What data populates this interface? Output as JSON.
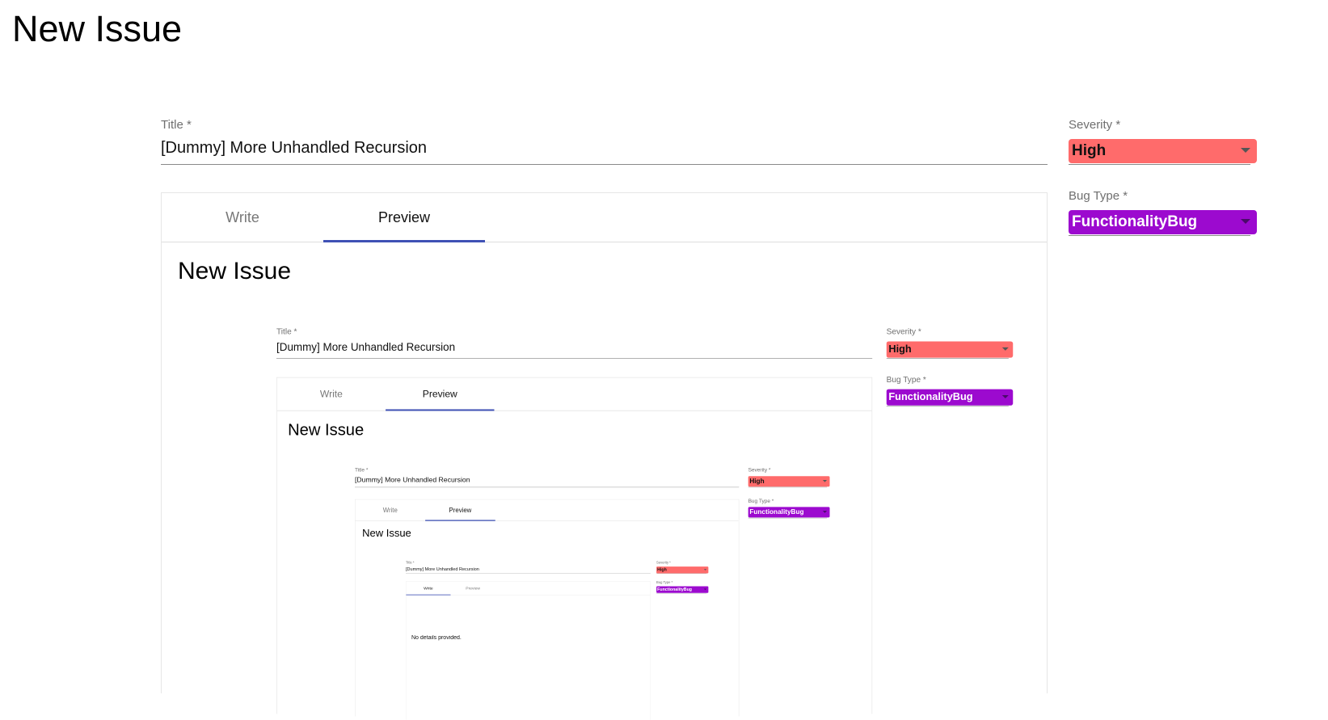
{
  "page": {
    "title": "New Issue"
  },
  "form": {
    "title_label": "Title *",
    "title_value": "[Dummy] More Unhandled Recursion",
    "tabs": [
      {
        "label": "Write",
        "active": false
      },
      {
        "label": "Preview",
        "active": true
      }
    ],
    "preview_heading": "New Issue",
    "severity_label": "Severity *",
    "severity_value": "High",
    "bug_type_label": "Bug Type *",
    "bug_type_value": "FunctionalityBug"
  },
  "innermost_preview": {
    "text": "No details provided."
  },
  "colors": {
    "severity_high": "#ff6b6b",
    "bug_type_functionality": "#9c0acf",
    "tab_indicator": "#3f51b5"
  }
}
